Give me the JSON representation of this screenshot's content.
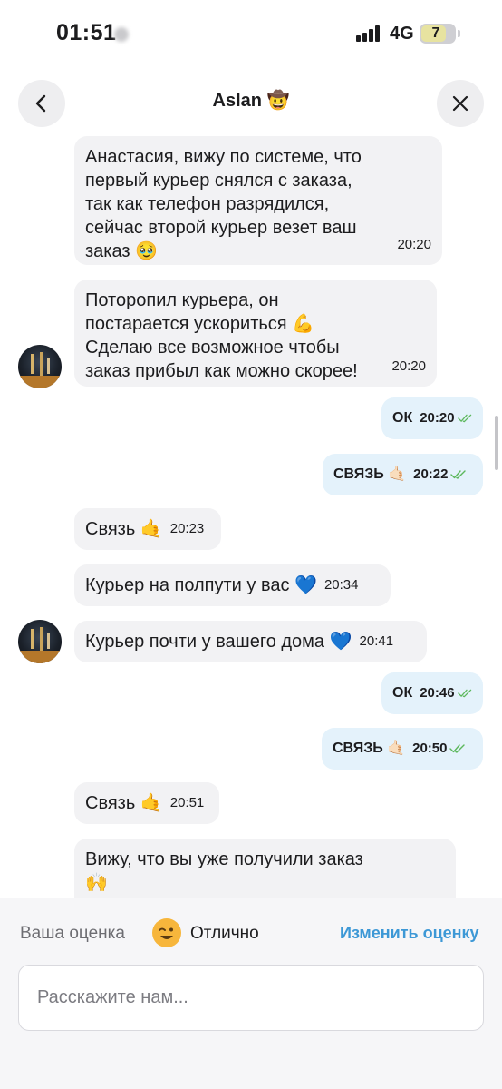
{
  "status_bar": {
    "time": "01:51",
    "network": "4G",
    "battery": "7"
  },
  "header": {
    "title": "Aslan 🤠"
  },
  "messages": [
    {
      "dir": "in",
      "text": "Анастасия, вижу по системе, что\nпервый курьер снялся с заказа,\nтак как телефон разрядился,\nсейчас второй курьер везет ваш\nзаказ 🥹",
      "time": "20:20"
    },
    {
      "dir": "in",
      "text": "Поторопил курьера, он\nпостарается ускориться 💪\nСделаю все возможное чтобы\nзаказ прибыл как можно скорее!",
      "time": "20:20"
    },
    {
      "dir": "out",
      "text": "ОК",
      "time": "20:20"
    },
    {
      "dir": "out",
      "text": "СВЯЗЬ 🤙🏻",
      "time": "20:22"
    },
    {
      "dir": "in",
      "text": "Связь 🤙",
      "time": "20:23"
    },
    {
      "dir": "in",
      "text": "Курьер на полпути у вас 💙",
      "time": "20:34"
    },
    {
      "dir": "in",
      "text": "Курьер почти у вашего дома 💙",
      "time": "20:41"
    },
    {
      "dir": "out",
      "text": "ОК",
      "time": "20:46"
    },
    {
      "dir": "out",
      "text": "СВЯЗЬ 🤙🏻",
      "time": "20:50"
    },
    {
      "dir": "in",
      "text": "Связь 🤙",
      "time": "20:51"
    },
    {
      "dir": "in",
      "text": "Вижу, что вы уже получили заказ\n🙌",
      "time": ""
    }
  ],
  "rating": {
    "label": "Ваша оценка",
    "value": "Отлично",
    "change_label": "Изменить оценку"
  },
  "feedback": {
    "placeholder": "Расскажите нам..."
  },
  "colors": {
    "incoming_bubble": "#f2f2f4",
    "outgoing_bubble": "#e4f2fb",
    "accent_link": "#3d98d6",
    "read_ticks": "#5cb85c"
  }
}
